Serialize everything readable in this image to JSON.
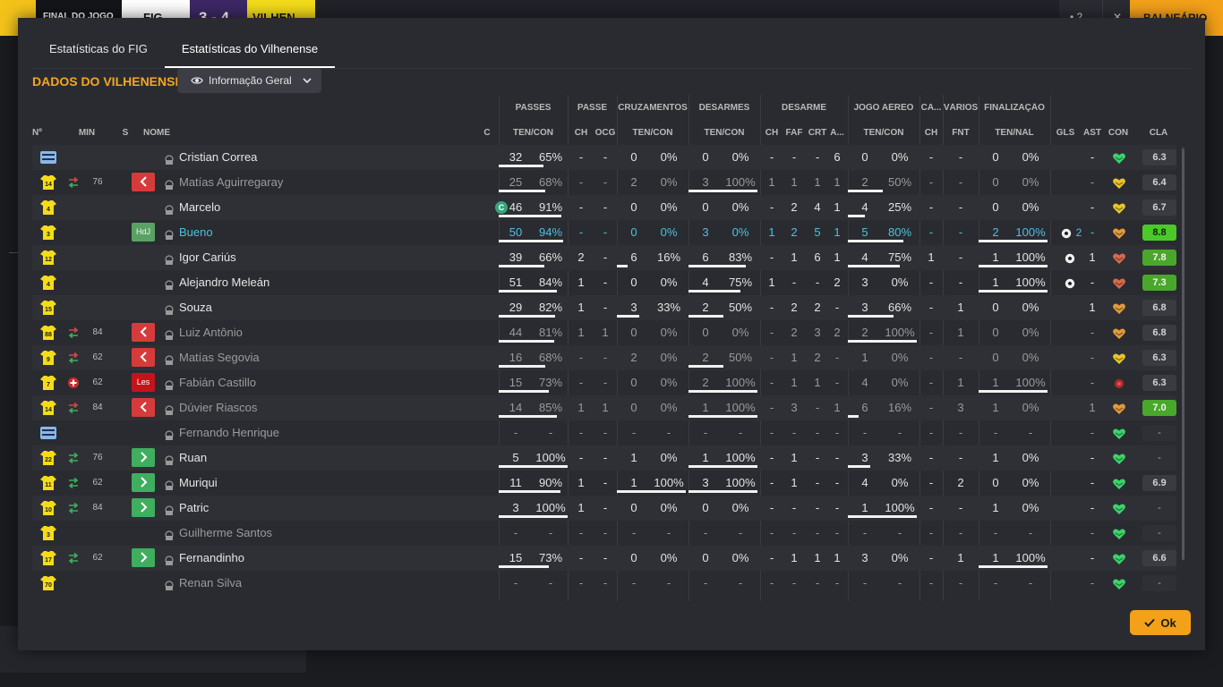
{
  "topbar": {
    "final_label": "FINAL DO JOGO",
    "home_team": "FIG",
    "score": "3 - 4",
    "away_team": "VILHEN",
    "right_btn1": "• 2",
    "right_btn2": "✕",
    "right_btn3": "BALNEÁRIO"
  },
  "tabs": [
    {
      "label": "Estatísticas do FIG",
      "active": false
    },
    {
      "label": "Estatísticas do Vilhenense",
      "active": true
    }
  ],
  "section_title": "DADOS DO VILHENENSE",
  "view_dropdown": {
    "label": "Informação Geral",
    "icon": "eye-icon"
  },
  "ok_button": {
    "label": "Ok",
    "icon": "check-icon"
  },
  "group_headers": [
    "PASSES",
    "PASSE",
    "CRUZAMENTOS",
    "DESARMES",
    "DESARME",
    "JOGO AÉREO",
    "CA...",
    "VÁRIOS",
    "FINALIZAÇÃO"
  ],
  "column_headers": [
    "Nº",
    "MIN",
    "S",
    "NOME",
    "C",
    "TEN/CON",
    "CH",
    "OCG",
    "TEN/CON",
    "TEN/CON",
    "CH",
    "FAF",
    "CRT",
    "A...",
    "TEN/CON",
    "CH",
    "FNT",
    "TEN/NAL",
    "GLS",
    "AST",
    "CON",
    "CLA"
  ],
  "colors": {
    "accent": "#f4a622",
    "kit_yellow": "#f4dc1a",
    "sub_out": "#d63b3b",
    "sub_in": "#3fae5f",
    "rating_good": "#49a82b",
    "info_blue": "#4ec0de"
  },
  "players": [
    {
      "num": "",
      "kit": "gk",
      "sub": "",
      "min": "",
      "badge": "",
      "name": "Cristian Correa",
      "style": "",
      "captain": false,
      "pass": [
        "32",
        "65%"
      ],
      "pass_fill": 0.65,
      "p_ch": "-",
      "p_ocg": "-",
      "cross": [
        "0",
        "0%"
      ],
      "cross_fill": 0,
      "tack": [
        "0",
        "0%"
      ],
      "tack_fill": 0,
      "d_ch": "-",
      "d_faf": "-",
      "d_crt": "-",
      "d_a": "6",
      "air": [
        "0",
        "0%"
      ],
      "air_fill": 0,
      "ca_ch": "-",
      "fnt": "-",
      "shot": [
        "0",
        "0%"
      ],
      "shot_fill": 0,
      "gls": "",
      "ast": "-",
      "con": "green",
      "rating": "6.3",
      "rating_style": ""
    },
    {
      "num": "14",
      "kit": "yellow",
      "sub": "out",
      "min": "76",
      "badge": "out",
      "name": "Matías Aguirregaray",
      "style": "dim",
      "captain": false,
      "pass": [
        "25",
        "68%"
      ],
      "pass_fill": 0.68,
      "p_ch": "-",
      "p_ocg": "-",
      "cross": [
        "2",
        "0%"
      ],
      "cross_fill": 0,
      "tack": [
        "3",
        "100%"
      ],
      "tack_fill": 1,
      "d_ch": "1",
      "d_faf": "1",
      "d_crt": "1",
      "d_a": "1",
      "air": [
        "2",
        "50%"
      ],
      "air_fill": 0.5,
      "ca_ch": "-",
      "fnt": "-",
      "shot": [
        "0",
        "0%"
      ],
      "shot_fill": 0,
      "gls": "",
      "ast": "-",
      "con": "yellow",
      "rating": "6.4",
      "rating_style": ""
    },
    {
      "num": "4",
      "kit": "yellow",
      "sub": "",
      "min": "",
      "badge": "",
      "name": "Marcelo",
      "style": "",
      "captain": true,
      "pass": [
        "46",
        "91%"
      ],
      "pass_fill": 0.91,
      "p_ch": "-",
      "p_ocg": "-",
      "cross": [
        "0",
        "0%"
      ],
      "cross_fill": 0,
      "tack": [
        "0",
        "0%"
      ],
      "tack_fill": 0,
      "d_ch": "-",
      "d_faf": "2",
      "d_crt": "4",
      "d_a": "1",
      "air": [
        "4",
        "25%"
      ],
      "air_fill": 0.25,
      "ca_ch": "-",
      "fnt": "-",
      "shot": [
        "0",
        "0%"
      ],
      "shot_fill": 0,
      "gls": "",
      "ast": "-",
      "con": "yellow",
      "rating": "6.7",
      "rating_style": ""
    },
    {
      "num": "3",
      "kit": "yellow",
      "sub": "",
      "min": "",
      "badge": "hdj",
      "name": "Bueno",
      "style": "blue",
      "captain": false,
      "pass": [
        "50",
        "94%"
      ],
      "pass_fill": 0.94,
      "p_ch": "-",
      "p_ocg": "-",
      "cross": [
        "0",
        "0%"
      ],
      "cross_fill": 0,
      "tack": [
        "3",
        "0%"
      ],
      "tack_fill": 0,
      "d_ch": "1",
      "d_faf": "2",
      "d_crt": "5",
      "d_a": "1",
      "air": [
        "5",
        "80%"
      ],
      "air_fill": 0.8,
      "ca_ch": "-",
      "fnt": "-",
      "shot": [
        "2",
        "100%"
      ],
      "shot_fill": 1,
      "gls": "2",
      "ast": "-",
      "con": "orange",
      "rating": "8.8",
      "rating_style": "top"
    },
    {
      "num": "12",
      "kit": "yellow",
      "sub": "",
      "min": "",
      "badge": "",
      "name": "Igor Cariús",
      "style": "",
      "captain": false,
      "pass": [
        "39",
        "66%"
      ],
      "pass_fill": 0.66,
      "p_ch": "2",
      "p_ocg": "-",
      "cross": [
        "6",
        "16%"
      ],
      "cross_fill": 0.16,
      "tack": [
        "6",
        "83%"
      ],
      "tack_fill": 0.83,
      "d_ch": "-",
      "d_faf": "1",
      "d_crt": "6",
      "d_a": "1",
      "air": [
        "4",
        "75%"
      ],
      "air_fill": 0.75,
      "ca_ch": "1",
      "fnt": "-",
      "shot": [
        "1",
        "100%"
      ],
      "shot_fill": 1,
      "gls": "1",
      "ast": "1",
      "con": "red",
      "rating": "7.8",
      "rating_style": "good"
    },
    {
      "num": "4",
      "kit": "yellow",
      "sub": "",
      "min": "",
      "badge": "",
      "name": "Alejandro Meleán",
      "style": "",
      "captain": false,
      "pass": [
        "51",
        "84%"
      ],
      "pass_fill": 0.84,
      "p_ch": "1",
      "p_ocg": "-",
      "cross": [
        "0",
        "0%"
      ],
      "cross_fill": 0,
      "tack": [
        "4",
        "75%"
      ],
      "tack_fill": 0.75,
      "d_ch": "1",
      "d_faf": "-",
      "d_crt": "-",
      "d_a": "2",
      "air": [
        "3",
        "0%"
      ],
      "air_fill": 0,
      "ca_ch": "-",
      "fnt": "-",
      "shot": [
        "1",
        "100%"
      ],
      "shot_fill": 1,
      "gls": "1",
      "ast": "-",
      "con": "red",
      "rating": "7.3",
      "rating_style": "good"
    },
    {
      "num": "15",
      "kit": "yellow",
      "sub": "",
      "min": "",
      "badge": "",
      "name": "Souza",
      "style": "",
      "captain": false,
      "pass": [
        "29",
        "82%"
      ],
      "pass_fill": 0.82,
      "p_ch": "1",
      "p_ocg": "-",
      "cross": [
        "3",
        "33%"
      ],
      "cross_fill": 0.33,
      "tack": [
        "2",
        "50%"
      ],
      "tack_fill": 0.5,
      "d_ch": "-",
      "d_faf": "2",
      "d_crt": "2",
      "d_a": "-",
      "air": [
        "3",
        "66%"
      ],
      "air_fill": 0.66,
      "ca_ch": "-",
      "fnt": "1",
      "shot": [
        "0",
        "0%"
      ],
      "shot_fill": 0,
      "gls": "",
      "ast": "1",
      "con": "orange",
      "rating": "6.8",
      "rating_style": ""
    },
    {
      "num": "88",
      "kit": "yellow",
      "sub": "out",
      "min": "84",
      "badge": "out",
      "name": "Luiz Antônio",
      "style": "dim",
      "captain": false,
      "pass": [
        "44",
        "81%"
      ],
      "pass_fill": 0.81,
      "p_ch": "1",
      "p_ocg": "1",
      "cross": [
        "0",
        "0%"
      ],
      "cross_fill": 0,
      "tack": [
        "0",
        "0%"
      ],
      "tack_fill": 0,
      "d_ch": "-",
      "d_faf": "2",
      "d_crt": "3",
      "d_a": "2",
      "air": [
        "2",
        "100%"
      ],
      "air_fill": 1,
      "ca_ch": "-",
      "fnt": "1",
      "shot": [
        "0",
        "0%"
      ],
      "shot_fill": 0,
      "gls": "",
      "ast": "-",
      "con": "orange",
      "rating": "6.8",
      "rating_style": ""
    },
    {
      "num": "9",
      "kit": "yellow",
      "sub": "out",
      "min": "62",
      "badge": "out",
      "name": "Matías Segovia",
      "style": "dim",
      "captain": false,
      "pass": [
        "16",
        "68%"
      ],
      "pass_fill": 0.68,
      "p_ch": "-",
      "p_ocg": "-",
      "cross": [
        "2",
        "0%"
      ],
      "cross_fill": 0,
      "tack": [
        "2",
        "50%"
      ],
      "tack_fill": 0.5,
      "d_ch": "-",
      "d_faf": "1",
      "d_crt": "2",
      "d_a": "-",
      "air": [
        "1",
        "0%"
      ],
      "air_fill": 0,
      "ca_ch": "-",
      "fnt": "-",
      "shot": [
        "0",
        "0%"
      ],
      "shot_fill": 0,
      "gls": "",
      "ast": "-",
      "con": "yellow",
      "rating": "6.3",
      "rating_style": ""
    },
    {
      "num": "7",
      "kit": "yellow",
      "sub": "injury",
      "min": "62",
      "badge": "les",
      "name": "Fabián Castillo",
      "style": "dim",
      "captain": false,
      "pass": [
        "15",
        "73%"
      ],
      "pass_fill": 0.73,
      "p_ch": "-",
      "p_ocg": "-",
      "cross": [
        "0",
        "0%"
      ],
      "cross_fill": 0,
      "tack": [
        "2",
        "100%"
      ],
      "tack_fill": 1,
      "d_ch": "-",
      "d_faf": "1",
      "d_crt": "1",
      "d_a": "-",
      "air": [
        "4",
        "0%"
      ],
      "air_fill": 0,
      "ca_ch": "-",
      "fnt": "1",
      "shot": [
        "1",
        "100%"
      ],
      "shot_fill": 1,
      "gls": "",
      "ast": "-",
      "con": "dot",
      "rating": "6.3",
      "rating_style": ""
    },
    {
      "num": "14",
      "kit": "yellow",
      "sub": "out",
      "min": "84",
      "badge": "out",
      "name": "Dúvier Riascos",
      "style": "dim",
      "captain": false,
      "pass": [
        "14",
        "85%"
      ],
      "pass_fill": 0.85,
      "p_ch": "1",
      "p_ocg": "1",
      "cross": [
        "0",
        "0%"
      ],
      "cross_fill": 0,
      "tack": [
        "1",
        "100%"
      ],
      "tack_fill": 1,
      "d_ch": "-",
      "d_faf": "3",
      "d_crt": "-",
      "d_a": "1",
      "air": [
        "6",
        "16%"
      ],
      "air_fill": 0.16,
      "ca_ch": "-",
      "fnt": "3",
      "shot": [
        "1",
        "0%"
      ],
      "shot_fill": 0,
      "gls": "",
      "ast": "1",
      "con": "orange",
      "rating": "7.0",
      "rating_style": "good"
    },
    {
      "num": "",
      "kit": "gk",
      "sub": "",
      "min": "",
      "badge": "",
      "name": "Fernando Henrique",
      "style": "dim",
      "captain": false,
      "pass": [
        "-",
        "-"
      ],
      "pass_fill": 0,
      "p_ch": "-",
      "p_ocg": "-",
      "cross": [
        "-",
        "-"
      ],
      "cross_fill": 0,
      "tack": [
        "-",
        "-"
      ],
      "tack_fill": 0,
      "d_ch": "-",
      "d_faf": "-",
      "d_crt": "-",
      "d_a": "-",
      "air": [
        "-",
        "-"
      ],
      "air_fill": 0,
      "ca_ch": "-",
      "fnt": "-",
      "shot": [
        "-",
        "-"
      ],
      "shot_fill": 0,
      "gls": "",
      "ast": "-",
      "con": "green",
      "rating": "-",
      "rating_style": "none"
    },
    {
      "num": "22",
      "kit": "yellow",
      "sub": "in",
      "min": "76",
      "badge": "in",
      "name": "Ruan",
      "style": "",
      "captain": false,
      "pass": [
        "5",
        "100%"
      ],
      "pass_fill": 1,
      "p_ch": "-",
      "p_ocg": "-",
      "cross": [
        "1",
        "0%"
      ],
      "cross_fill": 0,
      "tack": [
        "1",
        "100%"
      ],
      "tack_fill": 1,
      "d_ch": "-",
      "d_faf": "1",
      "d_crt": "-",
      "d_a": "-",
      "air": [
        "3",
        "33%"
      ],
      "air_fill": 0.33,
      "ca_ch": "-",
      "fnt": "-",
      "shot": [
        "1",
        "0%"
      ],
      "shot_fill": 0,
      "gls": "",
      "ast": "-",
      "con": "green",
      "rating": "-",
      "rating_style": "none"
    },
    {
      "num": "11",
      "kit": "yellow",
      "sub": "in",
      "min": "62",
      "badge": "in",
      "name": "Muriqui",
      "style": "",
      "captain": false,
      "pass": [
        "11",
        "90%"
      ],
      "pass_fill": 0.9,
      "p_ch": "1",
      "p_ocg": "-",
      "cross": [
        "1",
        "100%"
      ],
      "cross_fill": 1,
      "tack": [
        "3",
        "100%"
      ],
      "tack_fill": 1,
      "d_ch": "-",
      "d_faf": "1",
      "d_crt": "-",
      "d_a": "-",
      "air": [
        "4",
        "0%"
      ],
      "air_fill": 0,
      "ca_ch": "-",
      "fnt": "2",
      "shot": [
        "0",
        "0%"
      ],
      "shot_fill": 0,
      "gls": "",
      "ast": "-",
      "con": "green",
      "rating": "6.9",
      "rating_style": ""
    },
    {
      "num": "10",
      "kit": "yellow",
      "sub": "in",
      "min": "84",
      "badge": "in",
      "name": "Patric",
      "style": "",
      "captain": false,
      "pass": [
        "3",
        "100%"
      ],
      "pass_fill": 1,
      "p_ch": "1",
      "p_ocg": "-",
      "cross": [
        "0",
        "0%"
      ],
      "cross_fill": 0,
      "tack": [
        "0",
        "0%"
      ],
      "tack_fill": 0,
      "d_ch": "-",
      "d_faf": "-",
      "d_crt": "-",
      "d_a": "-",
      "air": [
        "1",
        "100%"
      ],
      "air_fill": 1,
      "ca_ch": "-",
      "fnt": "-",
      "shot": [
        "1",
        "0%"
      ],
      "shot_fill": 0,
      "gls": "",
      "ast": "-",
      "con": "green",
      "rating": "-",
      "rating_style": "none"
    },
    {
      "num": "3",
      "kit": "yellow",
      "sub": "",
      "min": "",
      "badge": "",
      "name": "Guilherme Santos",
      "style": "dim",
      "captain": false,
      "pass": [
        "-",
        "-"
      ],
      "pass_fill": 0,
      "p_ch": "-",
      "p_ocg": "-",
      "cross": [
        "-",
        "-"
      ],
      "cross_fill": 0,
      "tack": [
        "-",
        "-"
      ],
      "tack_fill": 0,
      "d_ch": "-",
      "d_faf": "-",
      "d_crt": "-",
      "d_a": "-",
      "air": [
        "-",
        "-"
      ],
      "air_fill": 0,
      "ca_ch": "-",
      "fnt": "-",
      "shot": [
        "-",
        "-"
      ],
      "shot_fill": 0,
      "gls": "",
      "ast": "-",
      "con": "green",
      "rating": "-",
      "rating_style": "none"
    },
    {
      "num": "17",
      "kit": "yellow",
      "sub": "in",
      "min": "62",
      "badge": "in",
      "name": "Fernandinho",
      "style": "",
      "captain": false,
      "pass": [
        "15",
        "73%"
      ],
      "pass_fill": 0.73,
      "p_ch": "-",
      "p_ocg": "-",
      "cross": [
        "0",
        "0%"
      ],
      "cross_fill": 0,
      "tack": [
        "0",
        "0%"
      ],
      "tack_fill": 0,
      "d_ch": "-",
      "d_faf": "1",
      "d_crt": "1",
      "d_a": "1",
      "air": [
        "3",
        "0%"
      ],
      "air_fill": 0,
      "ca_ch": "-",
      "fnt": "1",
      "shot": [
        "1",
        "100%"
      ],
      "shot_fill": 1,
      "gls": "",
      "ast": "-",
      "con": "green",
      "rating": "6.6",
      "rating_style": ""
    },
    {
      "num": "70",
      "kit": "yellow",
      "sub": "",
      "min": "",
      "badge": "",
      "name": "Renan Silva",
      "style": "dim",
      "captain": false,
      "pass": [
        "-",
        "-"
      ],
      "pass_fill": 0,
      "p_ch": "-",
      "p_ocg": "-",
      "cross": [
        "-",
        "-"
      ],
      "cross_fill": 0,
      "tack": [
        "-",
        "-"
      ],
      "tack_fill": 0,
      "d_ch": "-",
      "d_faf": "-",
      "d_crt": "-",
      "d_a": "-",
      "air": [
        "-",
        "-"
      ],
      "air_fill": 0,
      "ca_ch": "-",
      "fnt": "-",
      "shot": [
        "-",
        "-"
      ],
      "shot_fill": 0,
      "gls": "",
      "ast": "-",
      "con": "green",
      "rating": "-",
      "rating_style": "none"
    }
  ]
}
